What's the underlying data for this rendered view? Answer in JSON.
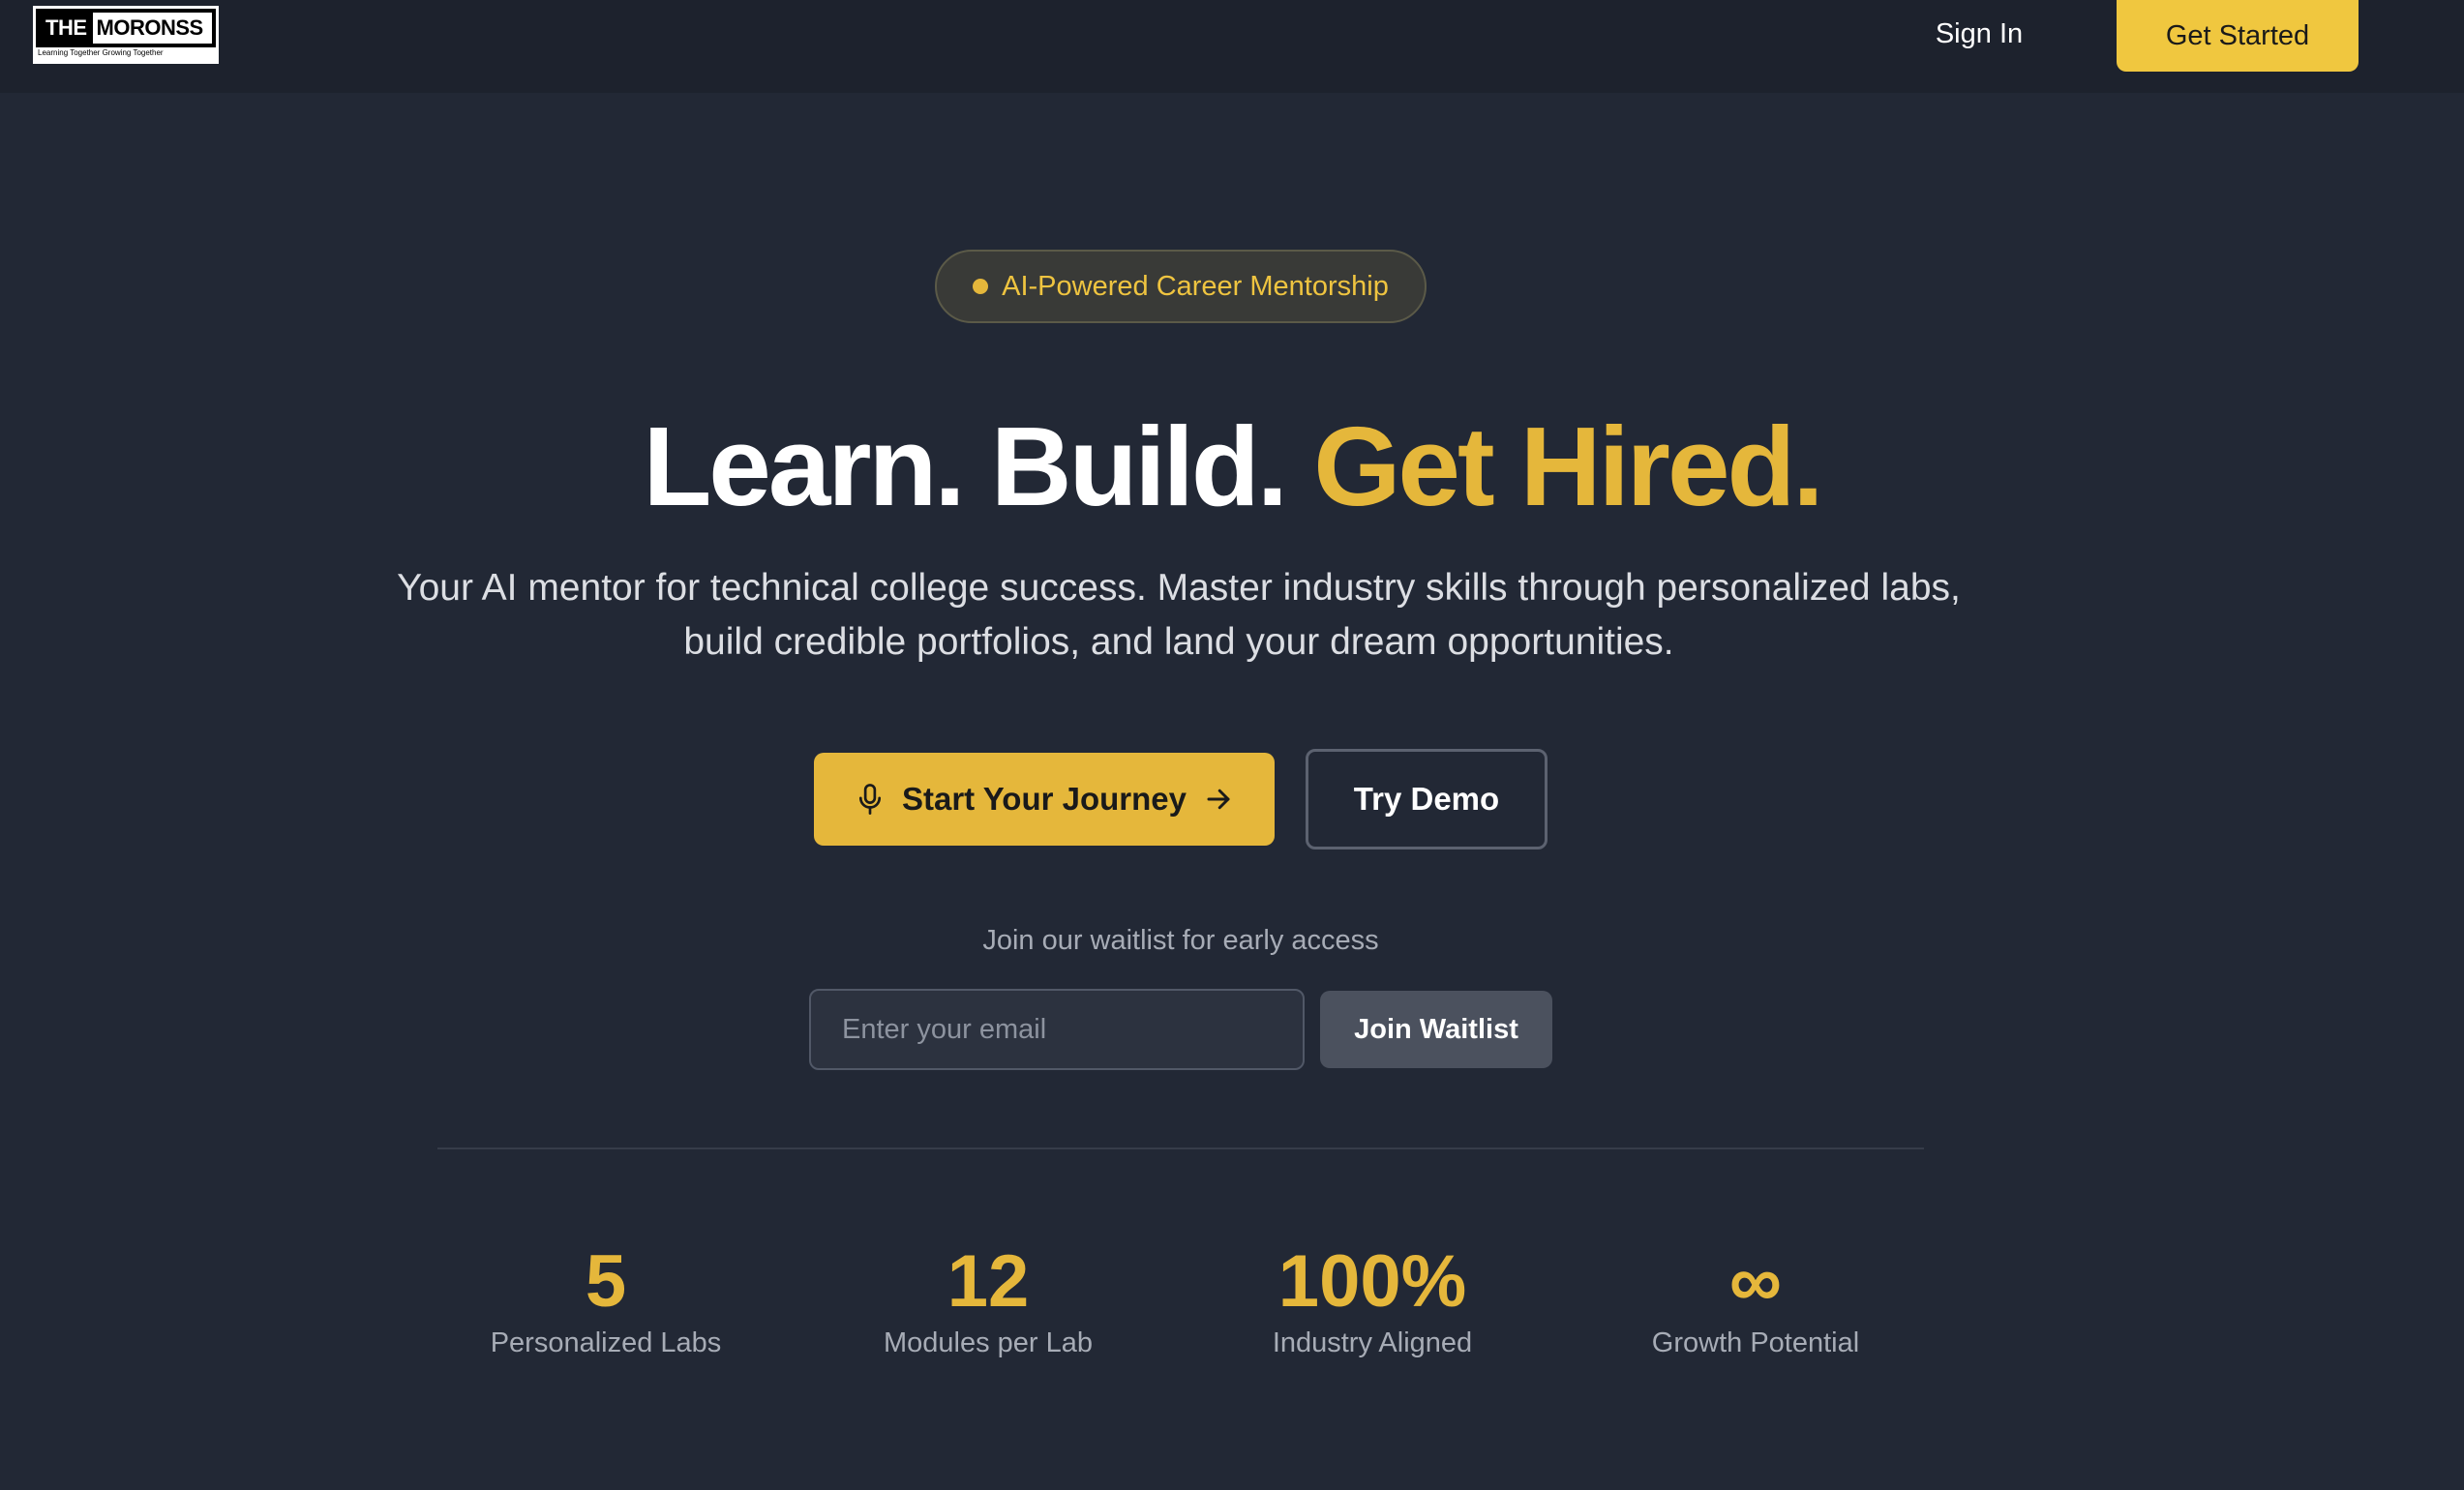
{
  "header": {
    "logo": {
      "the": "THE",
      "name": "MORONSS",
      "tagline": "Learning Together Growing Together"
    },
    "sign_in_label": "Sign In",
    "get_started_label": "Get Started"
  },
  "hero": {
    "badge_text": "AI-Powered Career Mentorship",
    "headline_part1": "Learn. Build. ",
    "headline_accent": "Get Hired.",
    "subtitle": "Your AI mentor for technical college success. Master industry skills through personalized labs, build credible portfolios, and land your dream opportunities.",
    "primary_cta_label": "Start Your Journey",
    "secondary_cta_label": "Try Demo",
    "primary_cta_icons": [
      "microphone-icon",
      "arrow-right-icon"
    ]
  },
  "waitlist": {
    "label": "Join our waitlist for early access",
    "email_placeholder": "Enter your email",
    "email_value": "",
    "button_label": "Join Waitlist"
  },
  "stats": [
    {
      "value": "5",
      "label": "Personalized Labs"
    },
    {
      "value": "12",
      "label": "Modules per Lab"
    },
    {
      "value": "100%",
      "label": "Industry Aligned"
    },
    {
      "value": "∞",
      "label": "Growth Potential"
    }
  ],
  "colors": {
    "background": "#222835",
    "header_background": "#1d222d",
    "accent": "#e5b73b",
    "get_started_button": "#f0c73f",
    "muted_text": "#a7acb6",
    "waitlist_button": "#4b515e"
  }
}
